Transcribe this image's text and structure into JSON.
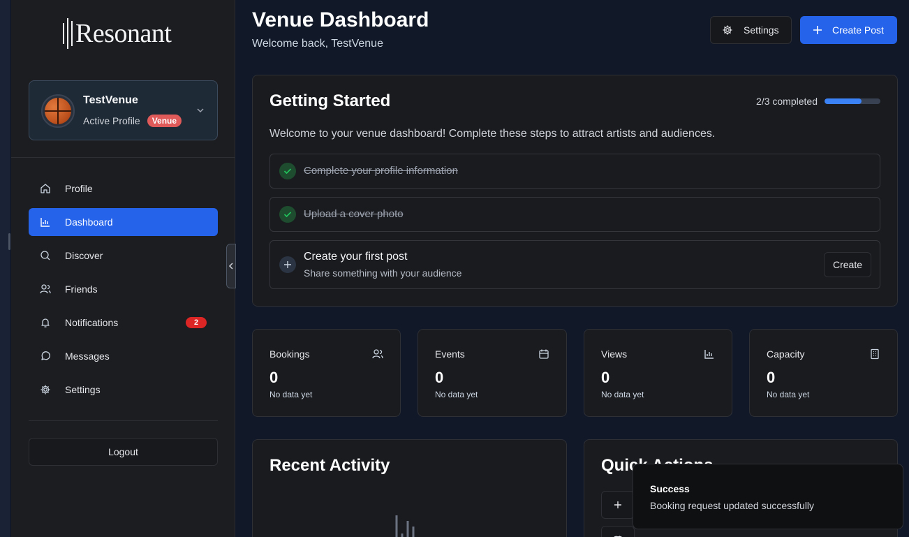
{
  "app": {
    "logo_text": "Resonant"
  },
  "profile": {
    "name": "TestVenue",
    "status": "Active Profile",
    "badge": "Venue"
  },
  "nav": {
    "items": [
      {
        "label": "Profile",
        "icon": "home-icon"
      },
      {
        "label": "Dashboard",
        "icon": "bar-chart-icon",
        "active": true
      },
      {
        "label": "Discover",
        "icon": "search-icon"
      },
      {
        "label": "Friends",
        "icon": "users-icon"
      },
      {
        "label": "Notifications",
        "icon": "bell-icon",
        "count": "2"
      },
      {
        "label": "Messages",
        "icon": "message-circle-icon"
      },
      {
        "label": "Settings",
        "icon": "gear-icon"
      }
    ],
    "logout_label": "Logout"
  },
  "header": {
    "title": "Venue Dashboard",
    "subtitle": "Welcome back, TestVenue",
    "settings_label": "Settings",
    "create_post_label": "Create Post"
  },
  "getting_started": {
    "title": "Getting Started",
    "progress_text": "2/3 completed",
    "progress_fraction": 0.667,
    "description": "Welcome to your venue dashboard! Complete these steps to attract artists and audiences.",
    "steps": [
      {
        "title": "Complete your profile information",
        "done": true
      },
      {
        "title": "Upload a cover photo",
        "done": true
      },
      {
        "title": "Create your first post",
        "subtitle": "Share something with your audience",
        "done": false,
        "action_label": "Create"
      }
    ]
  },
  "stats": [
    {
      "label": "Bookings",
      "value": "0",
      "note": "No data yet",
      "icon": "users-icon"
    },
    {
      "label": "Events",
      "value": "0",
      "note": "No data yet",
      "icon": "calendar-icon"
    },
    {
      "label": "Views",
      "value": "0",
      "note": "No data yet",
      "icon": "bar-chart-icon"
    },
    {
      "label": "Capacity",
      "value": "0",
      "note": "No data yet",
      "icon": "building-icon"
    }
  ],
  "recent_activity": {
    "title": "Recent Activity"
  },
  "quick_actions": {
    "title": "Quick Actions"
  },
  "toast": {
    "title": "Success",
    "message": "Booking request updated successfully"
  },
  "colors": {
    "accent": "#2563eb",
    "badge_red": "#e05a5a",
    "success_green": "#22c55e",
    "progress_blue": "#3b82f6"
  }
}
